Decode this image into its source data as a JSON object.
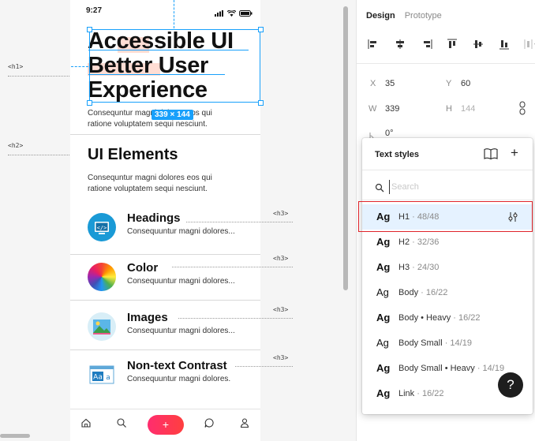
{
  "status_bar": {
    "time": "9:27"
  },
  "artboard": {
    "h1": [
      "Accessible UI",
      "Better User",
      "Experience"
    ],
    "h1_body": [
      "Consequntur magni dolores eos qui",
      "ratione voluptatem sequi nesciunt."
    ],
    "h2": "UI Elements",
    "h2_body": [
      "Consequntur magni dolores eos qui",
      "ratione voluptatem sequi nesciunt."
    ],
    "items": [
      {
        "title": "Headings",
        "subtitle": "Consequuntur magni dolores...",
        "icon": "code-icon"
      },
      {
        "title": "Color",
        "subtitle": "Consequuntur magni dolores...",
        "icon": "color-wheel-icon"
      },
      {
        "title": "Images",
        "subtitle": "Consequuntur magni dolores...",
        "icon": "image-icon"
      },
      {
        "title": "Non-text Contrast",
        "subtitle": "Consequuntur magni dolores.",
        "icon": "text-contrast-icon"
      }
    ],
    "tabbar": [
      "home-icon",
      "search-icon",
      "plus-icon",
      "chat-icon",
      "profile-icon"
    ],
    "plus_label": "+"
  },
  "annotations": {
    "h1": "<h1>",
    "h2": "<h2>",
    "h3": "<h3>"
  },
  "selection": {
    "size_badge": "339 × 144",
    "color": "#18a0fb"
  },
  "panel": {
    "tabs": [
      "Design",
      "Prototype"
    ],
    "fields": {
      "x_label": "X",
      "x": "35",
      "y_label": "Y",
      "y": "60",
      "w_label": "W",
      "w": "339",
      "h_label": "H",
      "h": "144",
      "rotation": "0°"
    }
  },
  "text_styles": {
    "title": "Text styles",
    "search_placeholder": "Search",
    "sample": "Ag",
    "styles": [
      {
        "name": "H1",
        "size": " · 48/48",
        "weight": "bold"
      },
      {
        "name": "H2",
        "size": " · 32/36",
        "weight": "bold"
      },
      {
        "name": "H3",
        "size": " · 24/30",
        "weight": "bold"
      },
      {
        "name": "Body",
        "size": " · 16/22",
        "weight": "normal"
      },
      {
        "name": "Body • Heavy",
        "size": " · 16/22",
        "weight": "bold"
      },
      {
        "name": "Body Small",
        "size": " · 14/19",
        "weight": "normal"
      },
      {
        "name": "Body Small • Heavy",
        "size": " · 14/19",
        "weight": "bold"
      },
      {
        "name": "Link",
        "size": " · 16/22",
        "weight": "bold"
      }
    ],
    "selected_index": 0
  },
  "help_label": "?"
}
